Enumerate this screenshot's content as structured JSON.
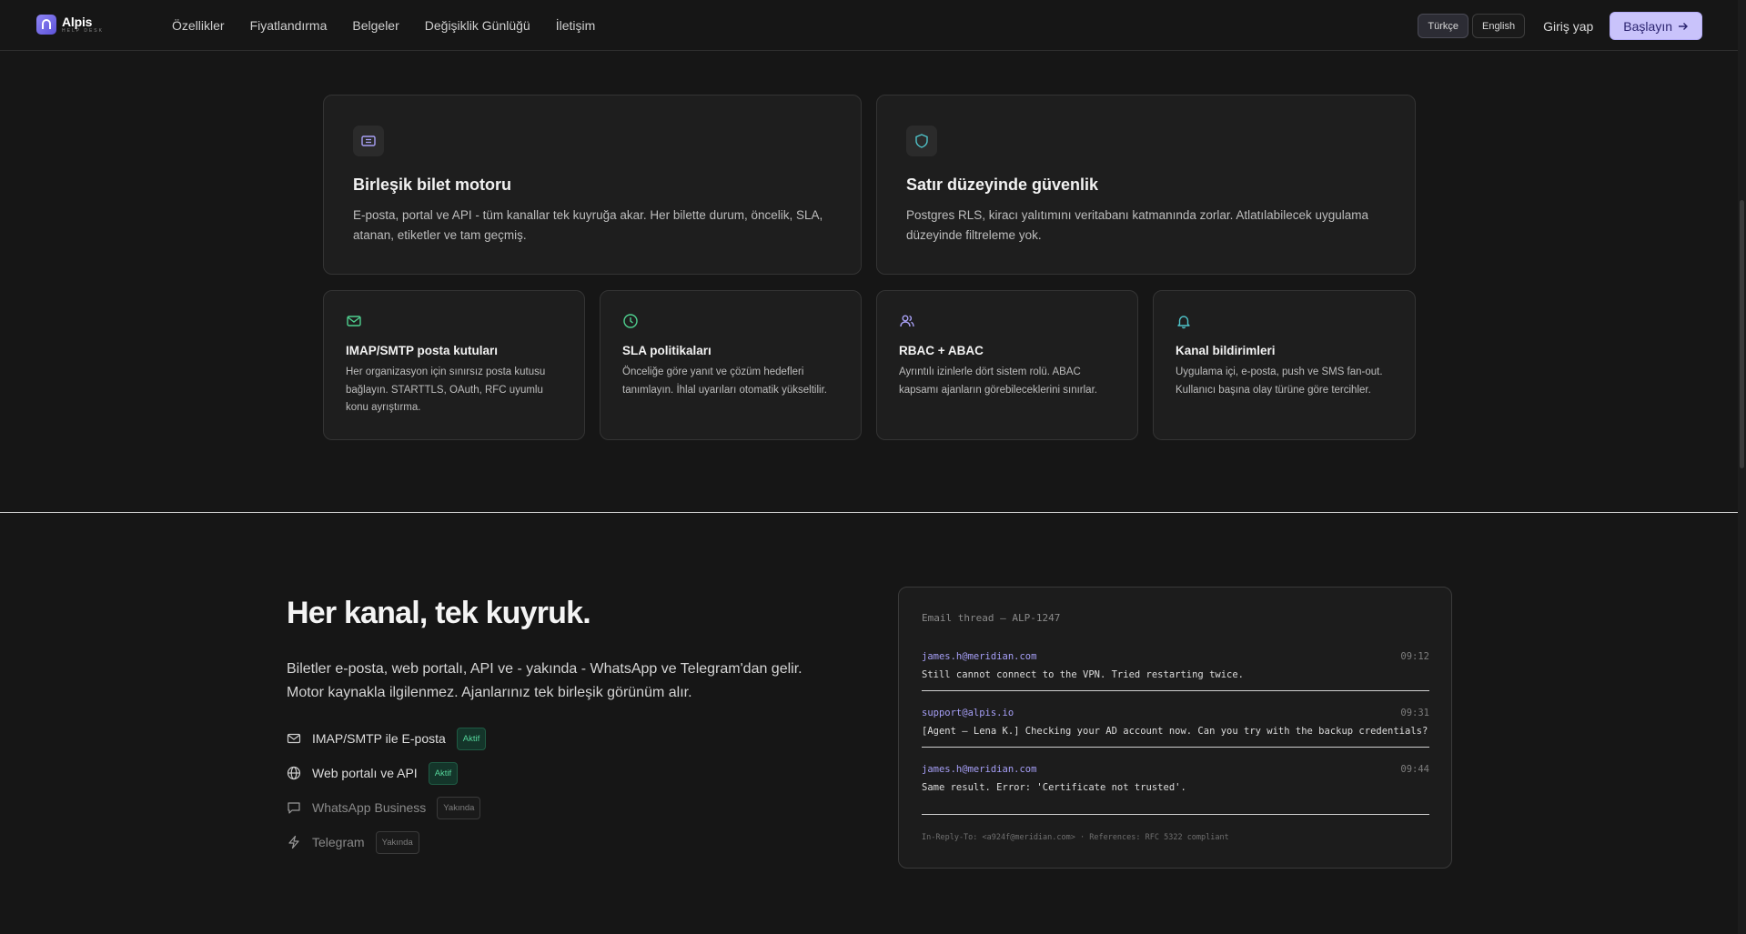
{
  "header": {
    "logo_name": "Alpis",
    "logo_sub": "HELP DESK",
    "nav": [
      "Özellikler",
      "Fiyatlandırma",
      "Belgeler",
      "Değişiklik Günlüğü",
      "İletişim"
    ],
    "lang_tr": "Türkçe",
    "lang_en": "English",
    "login": "Giriş yap",
    "cta": "Başlayın"
  },
  "features": {
    "big": [
      {
        "icon": "ticket-icon",
        "title": "Birleşik bilet motoru",
        "desc": "E-posta, portal ve API - tüm kanallar tek kuyruğa akar. Her bilette durum, öncelik, SLA, atanan, etiketler ve tam geçmiş."
      },
      {
        "icon": "shield-icon",
        "title": "Satır düzeyinde güvenlik",
        "desc": "Postgres RLS, kiracı yalıtımını veritabanı katmanında zorlar. Atlatılabilecek uygulama düzeyinde filtreleme yok."
      }
    ],
    "small": [
      {
        "icon": "mail-icon",
        "title": "IMAP/SMTP posta kutuları",
        "desc": "Her organizasyon için sınırsız posta kutusu bağlayın. STARTTLS, OAuth, RFC uyumlu konu ayrıştırma."
      },
      {
        "icon": "clock-icon",
        "title": "SLA politikaları",
        "desc": "Önceliğe göre yanıt ve çözüm hedefleri tanımlayın. İhlal uyarıları otomatik yükseltilir."
      },
      {
        "icon": "users-icon",
        "title": "RBAC + ABAC",
        "desc": "Ayrıntılı izinlerle dört sistem rolü. ABAC kapsamı ajanların görebileceklerini sınırlar."
      },
      {
        "icon": "bell-icon",
        "title": "Kanal bildirimleri",
        "desc": "Uygulama içi, e-posta, push ve SMS fan-out. Kullanıcı başına olay türüne göre tercihler."
      }
    ]
  },
  "channels_section": {
    "title": "Her kanal, tek kuyruk.",
    "desc": "Biletler e-posta, web portalı, API ve - yakında - WhatsApp ve Telegram'dan gelir. Motor kaynakla ilgilenmez. Ajanlarınız tek birleşik görünüm alır.",
    "channels": [
      {
        "icon": "mail-icon",
        "label": "IMAP/SMTP ile E-posta",
        "badge": "Aktif",
        "active": true
      },
      {
        "icon": "globe-icon",
        "label": "Web portalı ve API",
        "badge": "Aktif",
        "active": true
      },
      {
        "icon": "chat-icon",
        "label": "WhatsApp Business",
        "badge": "Yakında",
        "active": false
      },
      {
        "icon": "bolt-icon",
        "label": "Telegram",
        "badge": "Yakında",
        "active": false
      }
    ]
  },
  "thread": {
    "title": "Email thread — ALP-1247",
    "messages": [
      {
        "from": "james.h@meridian.com",
        "time": "09:12",
        "body": "Still cannot connect to the VPN. Tried restarting twice."
      },
      {
        "from": "support@alpis.io",
        "time": "09:31",
        "body": "[Agent — Lena K.] Checking your AD account now. Can you try with the backup credentials?"
      },
      {
        "from": "james.h@meridian.com",
        "time": "09:44",
        "body": "Same result. Error: 'Certificate not trusted'."
      }
    ],
    "footer": "In-Reply-To: <a924f@meridian.com> · References: RFC 5322 compliant"
  },
  "colors": {
    "accent": "#c9c3fb",
    "icon_purple": "#a8a0f5",
    "icon_teal": "#4fc3c9",
    "icon_green": "#4fd08f",
    "active_badge": "#55d49a"
  }
}
